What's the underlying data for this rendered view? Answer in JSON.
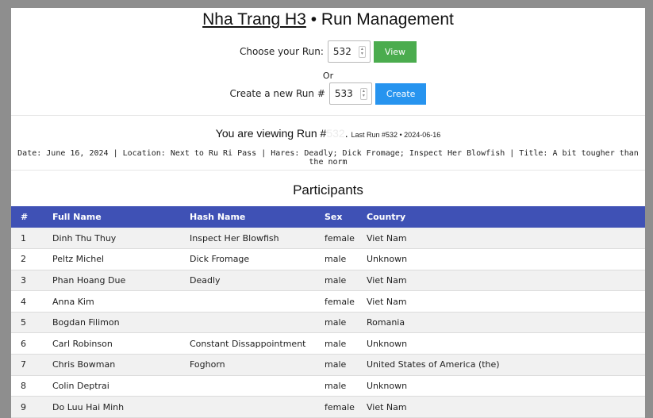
{
  "header": {
    "title_link": "Nha Trang H3",
    "title_sep": " • ",
    "title_rest": "Run Management"
  },
  "choose_run": {
    "label": "Choose your Run:",
    "value": "532",
    "button": "View"
  },
  "or_text": "Or",
  "create_run": {
    "label": "Create a new Run #",
    "value": "533",
    "button": "Create"
  },
  "viewing": {
    "prefix": "You are viewing Run #",
    "run_number": "532",
    "suffix": ".",
    "last_run": "Last Run #532 • 2024-06-16"
  },
  "run_details": "Date: June 16, 2024 | Location: Next to Ru Ri Pass | Hares: Deadly; Dick Fromage; Inspect Her Blowfish | Title: A bit tougher than the norm",
  "participants": {
    "title": "Participants",
    "columns": [
      "#",
      "Full Name",
      "Hash Name",
      "Sex",
      "Country"
    ],
    "rows": [
      [
        "1",
        "Dinh Thu Thuy",
        "Inspect Her Blowfish",
        "female",
        "Viet Nam"
      ],
      [
        "2",
        "Peltz Michel",
        "Dick Fromage",
        "male",
        "Unknown"
      ],
      [
        "3",
        "Phan Hoang Due",
        "Deadly",
        "male",
        "Viet Nam"
      ],
      [
        "4",
        "Anna Kim",
        "",
        "female",
        "Viet Nam"
      ],
      [
        "5",
        "Bogdan Filimon",
        "",
        "male",
        "Romania"
      ],
      [
        "6",
        "Carl Robinson",
        "Constant Dissappointment",
        "male",
        "Unknown"
      ],
      [
        "7",
        "Chris Bowman",
        "Foghorn",
        "male",
        "United States of America (the)"
      ],
      [
        "8",
        "Colin Deptrai",
        "",
        "male",
        "Unknown"
      ],
      [
        "9",
        "Do Luu Hai Minh",
        "",
        "female",
        "Viet Nam"
      ]
    ]
  },
  "colors": {
    "header_bg": "#3f51b5",
    "view_button": "#4bac4e",
    "create_button": "#2794ef"
  }
}
